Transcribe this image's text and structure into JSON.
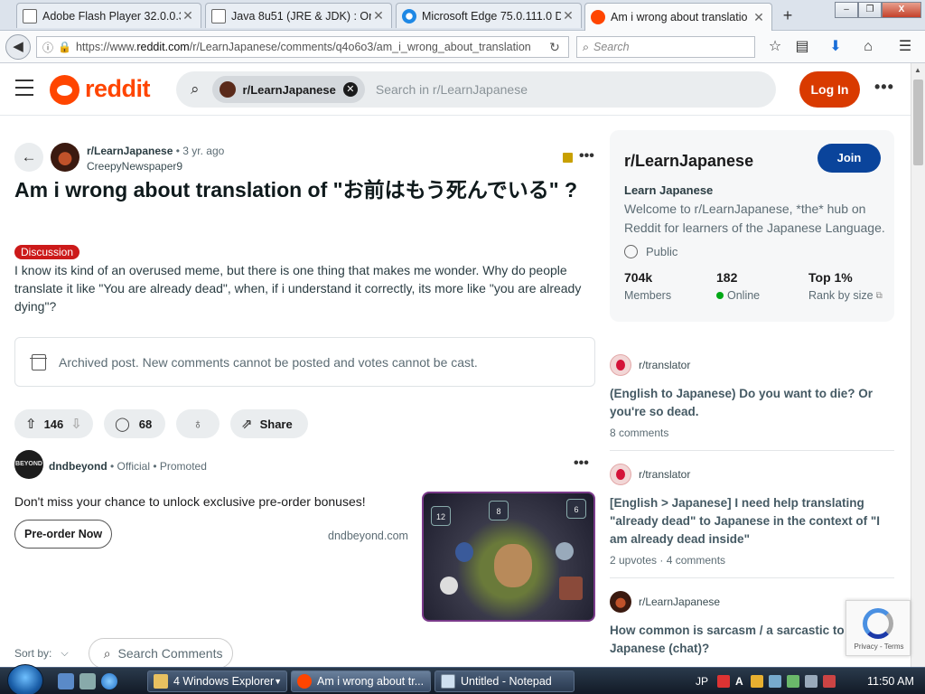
{
  "browser": {
    "tabs": [
      {
        "title": "Adobe Flash Player 32.0.0.37",
        "icon": "page-icon",
        "active": false
      },
      {
        "title": "Java 8u51 (JRE & JDK) : Orac",
        "icon": "page-icon",
        "active": false
      },
      {
        "title": "Microsoft Edge 75.0.111.0 D",
        "icon": "edge-icon",
        "active": false
      },
      {
        "title": "Am i wrong about translatio",
        "icon": "reddit-icon",
        "active": true
      }
    ],
    "new_tab": "+",
    "url_prefix": "https://www.",
    "url_domain": "reddit.com",
    "url_path": "/r/LearnJapanese/comments/q4o6o3/am_i_wrong_about_translation",
    "search_placeholder": "Search",
    "window_buttons": [
      "–",
      "❐",
      "X"
    ]
  },
  "header": {
    "logo_text": "reddit",
    "search_chip": "r/LearnJapanese",
    "search_placeholder": "Search in r/LearnJapanese",
    "login_label": "Log In",
    "more": "•••"
  },
  "post": {
    "subreddit": "r/LearnJapanese",
    "age": " • 3 yr. ago",
    "author": "CreepyNewspaper9",
    "title": "Am i wrong about translation of \"お前はもう死んでいる\" ?",
    "flair": "Discussion",
    "body": "I know its kind of an overused meme, but there is one thing that makes me wonder. Why do people translate it like \"You are already dead\", when, if i understand it correctly, its more like \"you are already dying\"?",
    "archived_notice": "Archived post. New comments cannot be posted and votes cannot be cast.",
    "upvotes": "146",
    "comments": "68",
    "share_label": "Share",
    "more": "•••"
  },
  "promoted": {
    "advertiser": "dndbeyond",
    "avatar_text": "BEYOND",
    "official": " • Official",
    "promoted": " • Promoted",
    "text": "Don't miss your chance to unlock exclusive pre-order bonuses!",
    "cta": "Pre-order Now",
    "domain": "dndbeyond.com",
    "dice": [
      "12",
      "8",
      "6"
    ]
  },
  "comments_bar": {
    "sort_label": "Sort by:",
    "search_placeholder": "Search Comments"
  },
  "sidebar": {
    "title": "r/LearnJapanese",
    "join_label": "Join",
    "subtitle": "Learn Japanese",
    "description": "Welcome to r/LearnJapanese, *the* hub on Reddit for learners of the Japanese Language.",
    "visibility": "Public",
    "members_value": "704k",
    "members_label": "Members",
    "online_value": "182",
    "online_label": "Online",
    "rank_value": "Top 1%",
    "rank_label": "Rank by size"
  },
  "related": [
    {
      "subreddit": "r/translator",
      "title": "(English to Japanese) Do you want to die? Or you're so dead.",
      "meta": "8 comments"
    },
    {
      "subreddit": "r/translator",
      "title": "[English > Japanese] I need help translating \"already dead\" to Japanese in the context of \"I am already dead inside\"",
      "meta": "2 upvotes · 4 comments"
    },
    {
      "subreddit": "r/LearnJapanese",
      "title": "How common is sarcasm / a sarcastic to Japanese (chat)?",
      "meta": ""
    }
  ],
  "recaptcha": {
    "text": "Privacy - Terms"
  },
  "taskbar": {
    "buttons": [
      {
        "label": "4 Windows Explorer",
        "active": false
      },
      {
        "label": "Am i wrong about tr...",
        "active": true
      },
      {
        "label": "Untitled - Notepad",
        "active": false
      }
    ],
    "lang": "JP",
    "ime": "A",
    "clock": "11:50 AM"
  },
  "colors": {
    "reddit_orange": "#ff4500",
    "login_bg": "#d93a00",
    "join_bg": "#0a449b",
    "flair_bg": "#cc1a1a",
    "online_dot": "#01a816"
  }
}
